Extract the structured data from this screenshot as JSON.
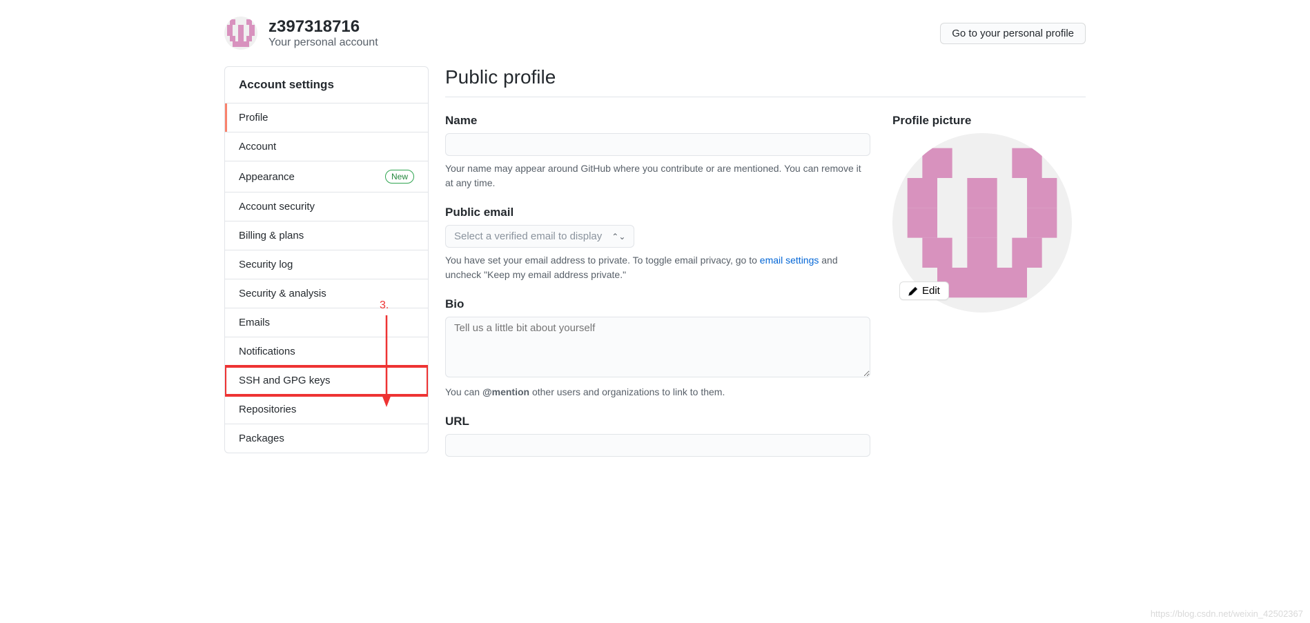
{
  "header": {
    "username": "z397318716",
    "subtitle": "Your personal account",
    "profile_btn": "Go to your personal profile"
  },
  "sidebar": {
    "title": "Account settings",
    "items": [
      {
        "label": "Profile"
      },
      {
        "label": "Account"
      },
      {
        "label": "Appearance",
        "badge": "New"
      },
      {
        "label": "Account security"
      },
      {
        "label": "Billing & plans"
      },
      {
        "label": "Security log"
      },
      {
        "label": "Security & analysis"
      },
      {
        "label": "Emails"
      },
      {
        "label": "Notifications"
      },
      {
        "label": "SSH and GPG keys"
      },
      {
        "label": "Repositories"
      },
      {
        "label": "Packages"
      }
    ]
  },
  "annotation": {
    "label": "3."
  },
  "page": {
    "title": "Public profile",
    "name": {
      "label": "Name",
      "value": "",
      "hint": "Your name may appear around GitHub where you contribute or are mentioned. You can remove it at any time."
    },
    "email": {
      "label": "Public email",
      "select_placeholder": "Select a verified email to display",
      "hint_pre": "You have set your email address to private. To toggle email privacy, go to ",
      "hint_link": "email settings",
      "hint_post": " and uncheck \"Keep my email address private.\""
    },
    "bio": {
      "label": "Bio",
      "placeholder": "Tell us a little bit about yourself",
      "hint_pre": "You can ",
      "hint_bold": "@mention",
      "hint_post": " other users and organizations to link to them."
    },
    "url": {
      "label": "URL",
      "value": ""
    },
    "picture": {
      "label": "Profile picture",
      "edit": "Edit"
    }
  },
  "watermark": "https://blog.csdn.net/weixin_42502367"
}
